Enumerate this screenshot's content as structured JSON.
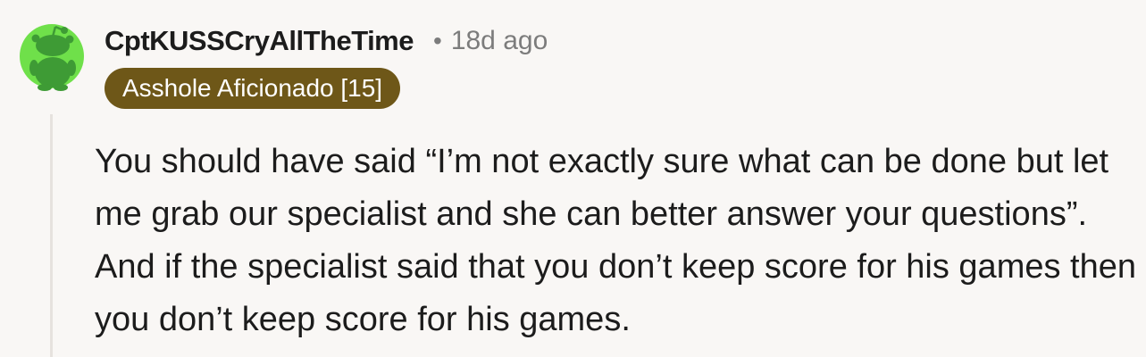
{
  "comment": {
    "author": "CptKUSSCryAllTheTime",
    "separator": "•",
    "timestamp": "18d ago",
    "flair": "Asshole Aficionado [15]",
    "body": "You should have said “I’m not exactly sure what can be done but let me grab our specialist and she can better answer your questions”. And if the specialist said that you don’t keep score for his games then you don’t keep score for his games."
  },
  "avatar": {
    "icon": "snoo-avatar-icon",
    "background_color": "#6fe04a",
    "figure_color": "#3e9b35"
  },
  "colors": {
    "flair_background": "#6e5718",
    "flair_text": "#ffffff",
    "page_background": "#f9f7f5",
    "meta_text": "#7c7c7c"
  }
}
